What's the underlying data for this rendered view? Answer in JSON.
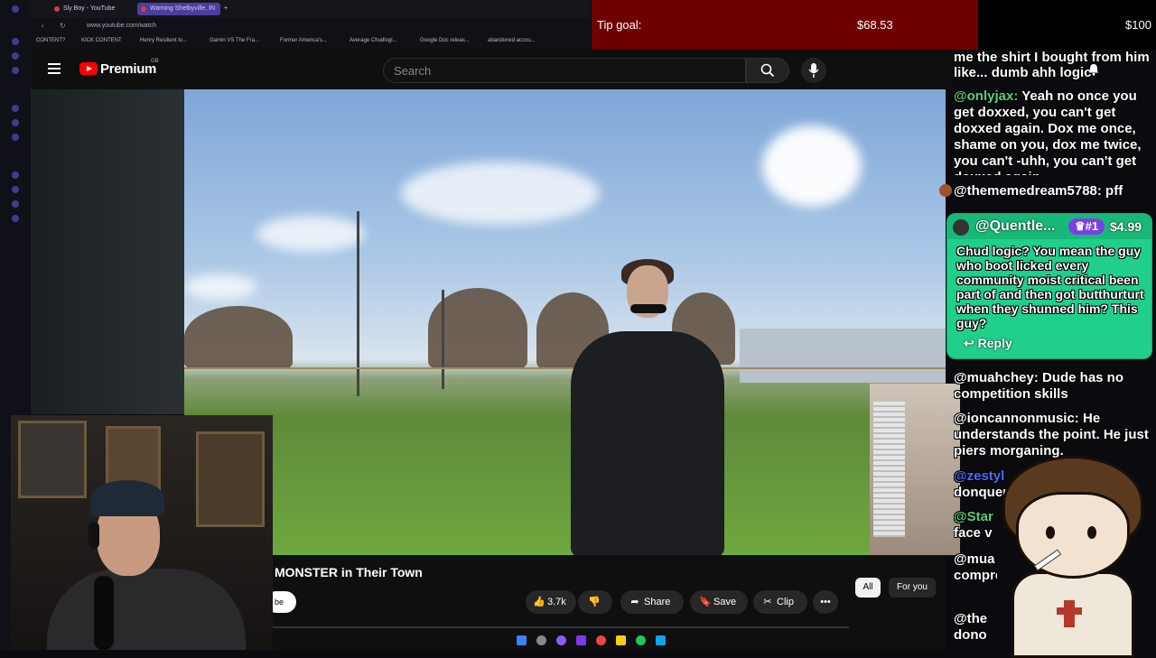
{
  "browser": {
    "tabs": [
      {
        "label": "Sly Boy - YouTube",
        "active": false
      },
      {
        "label": "Warning Shelbyville, IN",
        "active": true
      }
    ],
    "url": "www.youtube.com/watch",
    "bookmarks": [
      "CONTENT?",
      "KICK CONTENT",
      "Henry Resilient to...",
      "Gamin VS The Fra...",
      "Former America's...",
      "Average Chudlogi...",
      "Google Doc releas...",
      "abandoned accou..."
    ]
  },
  "tip_goal": {
    "label": "Tip goal:",
    "current": "$68.53",
    "target": "$100",
    "progress": 0.6853,
    "fill_color": "#6e0000"
  },
  "youtube": {
    "brand": "Premium",
    "region": "GB",
    "search_placeholder": "Search",
    "video_title": "MONSTER in Their Town",
    "channel_stub": "be",
    "actions": {
      "likes": "3.7k",
      "share": "Share",
      "save": "Save",
      "clip": "Clip"
    },
    "chips": [
      "All",
      "For you"
    ],
    "icons": [
      "menu-icon",
      "search-icon",
      "mic-icon",
      "like-icon",
      "dislike-icon",
      "share-icon",
      "save-icon",
      "clip-icon",
      "more-icon"
    ]
  },
  "chat": {
    "top_partial": [
      "me the shirt I bought from him",
      "like... dumb ahh logic"
    ],
    "messages": [
      {
        "user": "@onlyjax:",
        "text": "Yeah no once you get doxxed, you can't get doxxed again. Dox me once, shame on you, dox me twice, you can't -uhh, you can't get doxxed again."
      },
      {
        "user": "@thememedream5788:",
        "text": "pff"
      },
      {
        "user": "@muahchey:",
        "text": "Dude has no competition skills"
      },
      {
        "user": "@ioncannonmusic:",
        "text": "He understands the point. He just piers morganing."
      },
      {
        "user": "@zestyl",
        "text": "donquent"
      },
      {
        "user": "@Star",
        "text": "face v"
      },
      {
        "user": "@mua",
        "text": "comprehecompetiti"
      },
      {
        "user": "@the",
        "text": "dono"
      }
    ],
    "donation": {
      "name": "@Quentle...",
      "rank": "#1",
      "amount": "$4.99",
      "text": "Chud logic? You mean the guy who boot licked every community moist critical been part of and then got butthurturt when they shunned him? This guy?",
      "reply_label": "Reply",
      "card_color": "#1fcf8a"
    }
  }
}
